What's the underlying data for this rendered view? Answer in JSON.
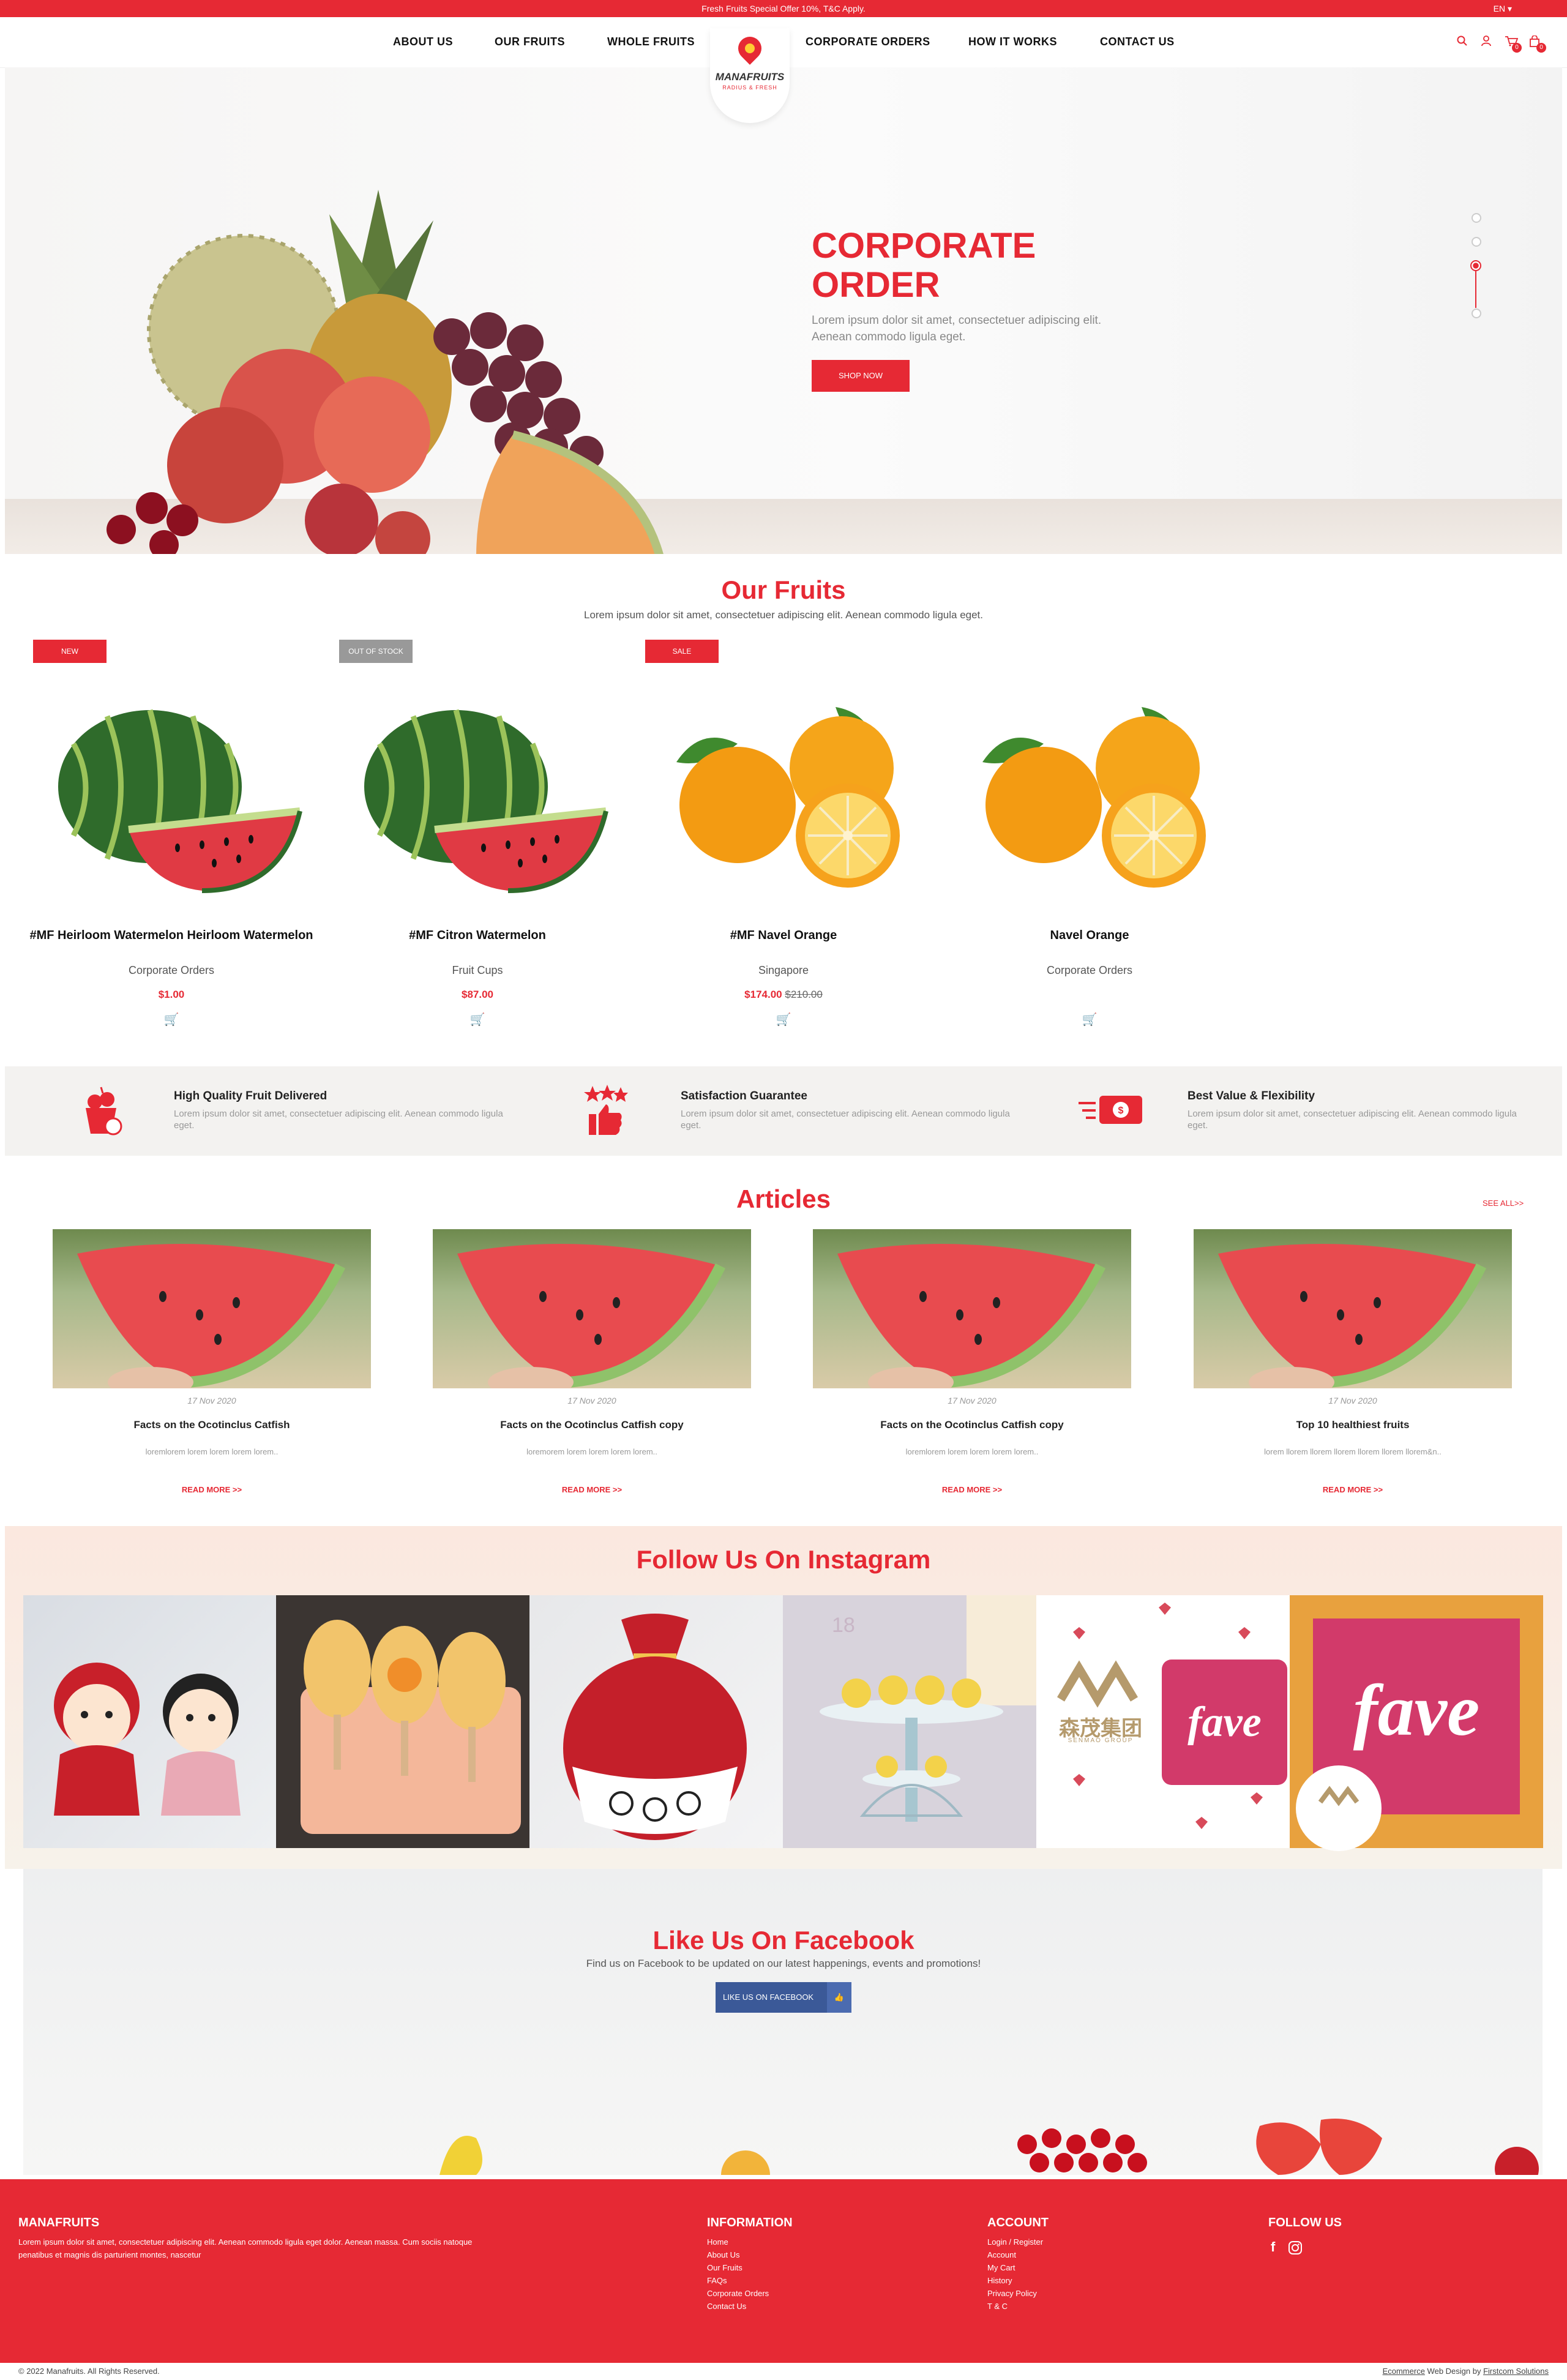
{
  "topbar": {
    "promo": "Fresh Fruits Special Offer 10%, T&C Apply.",
    "lang": "EN ▾"
  },
  "nav": {
    "items": [
      "ABOUT US",
      "OUR FRUITS",
      "WHOLE FRUITS",
      "CORPORATE ORDERS",
      "HOW IT WORKS",
      "CONTACT US"
    ],
    "logo_title": "MANAFRUITS",
    "logo_tagline": "RADIUS & FRESH",
    "cart_count": "0",
    "compare_count": "0"
  },
  "hero": {
    "title_line1": "CORPORATE",
    "title_line2": "ORDER",
    "text": "Lorem ipsum dolor sit amet, consectetuer adipiscing elit. Aenean commodo ligula eget.",
    "button": "SHOP NOW",
    "active_slide": 3,
    "slide_count": 4
  },
  "fruits": {
    "title": "Our Fruits",
    "subtitle": "Lorem ipsum dolor sit amet, consectetuer adipiscing elit. Aenean commodo ligula eget.",
    "products": [
      {
        "tag": "NEW",
        "name": "#MF Heirloom Watermelon Heirloom Watermelon",
        "category": "Corporate Orders",
        "price": "$1.00",
        "old_price": ""
      },
      {
        "tag": "OUT OF STOCK",
        "name": "#MF Citron Watermelon",
        "category": "Fruit Cups",
        "price": "$87.00",
        "old_price": ""
      },
      {
        "tag": "SALE",
        "name": "#MF Navel Orange",
        "category": "Singapore",
        "price": "$174.00",
        "old_price": "$210.00"
      },
      {
        "tag": "",
        "name": "Navel Orange",
        "category": "Corporate Orders",
        "price": "",
        "old_price": ""
      }
    ]
  },
  "features": [
    {
      "title": "High Quality Fruit Delivered",
      "text": "Lorem ipsum dolor sit amet, consectetuer adipiscing elit. Aenean commodo ligula eget."
    },
    {
      "title": "Satisfaction Guarantee",
      "text": "Lorem ipsum dolor sit amet, consectetuer adipiscing elit. Aenean commodo ligula eget."
    },
    {
      "title": "Best Value & Flexibility",
      "text": "Lorem ipsum dolor sit amet, consectetuer adipiscing elit. Aenean commodo ligula eget."
    }
  ],
  "articles": {
    "title": "Articles",
    "see_all": "SEE ALL>>",
    "items": [
      {
        "date": "17 Nov 2020",
        "title": "Facts on the Ocotinclus Catfish",
        "excerpt": "loremlorem lorem lorem lorem lorem..",
        "more": "READ MORE >>"
      },
      {
        "date": "17 Nov 2020",
        "title": "Facts on the Ocotinclus Catfish copy",
        "excerpt": "loremorem lorem lorem lorem lorem..",
        "more": "READ MORE >>"
      },
      {
        "date": "17 Nov 2020",
        "title": "Facts on the Ocotinclus Catfish copy",
        "excerpt": "loremlorem lorem lorem lorem lorem..",
        "more": "READ MORE >>"
      },
      {
        "date": "17 Nov 2020",
        "title": "Top 10 healthiest fruits",
        "excerpt": "lorem llorem llorem llorem llorem llorem llorem&n..",
        "more": "READ MORE >>"
      }
    ]
  },
  "instagram": {
    "title": "Follow Us On Instagram",
    "fave1": "fave",
    "fave2": "fave",
    "group_cn": "森茂集团",
    "group_en": "SENMAO GROUP",
    "cake_number": "18"
  },
  "facebook": {
    "title": "Like Us On Facebook",
    "text": "Find us on Facebook to be updated on our latest happenings, events and promotions!",
    "button": "LIKE US ON FACEBOOK"
  },
  "footer": {
    "brand": "MANAFRUITS",
    "about": "Lorem ipsum dolor sit amet, consectetuer adipiscing elit. Aenean commodo ligula eget dolor. Aenean massa. Cum sociis natoque penatibus et magnis dis parturient montes, nascetur",
    "info_title": "INFORMATION",
    "info_links": [
      "Home",
      "About Us",
      "Our Fruits",
      "FAQs",
      "Corporate Orders",
      "Contact Us"
    ],
    "account_title": "ACCOUNT",
    "account_links": [
      "Login / Register",
      "Account",
      "My Cart",
      "History",
      "Privacy Policy",
      "T & C"
    ],
    "follow_title": "FOLLOW US",
    "copyright": "© 2022 Manafruits. All Rights Reserved.",
    "credit_link": "Ecommerce",
    "credit_mid": " Web Design by ",
    "credit_company": "Firstcom Solutions"
  },
  "colors": {
    "brand_red": "#e62934",
    "feature_bg": "#f3f2f0",
    "fb_blue": "#3b5998"
  }
}
